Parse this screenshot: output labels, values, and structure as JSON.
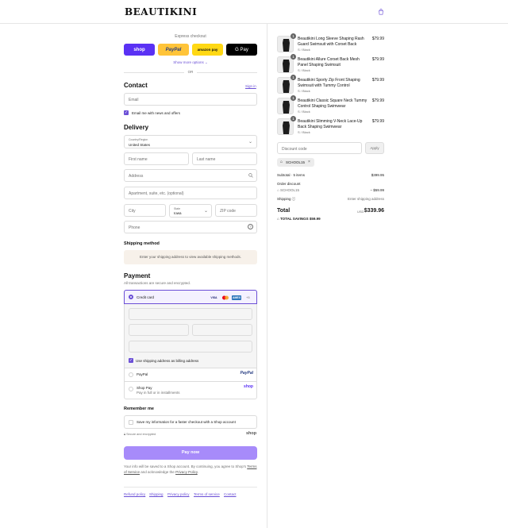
{
  "header": {
    "logo": "BEAUTIKINI"
  },
  "express": {
    "title": "Express checkout",
    "buttons": [
      {
        "label": "shop",
        "bg": "#5a31f4",
        "fg": "#ffffff"
      },
      {
        "label": "PayPal",
        "bg": "#ffc439",
        "fg": "#253b80"
      },
      {
        "label": "amazon pay",
        "bg": "#ffd814",
        "fg": "#111111"
      },
      {
        "label": "G Pay",
        "bg": "#000000",
        "fg": "#ffffff"
      }
    ],
    "more": "Show more options",
    "or": "OR"
  },
  "contact": {
    "title": "Contact",
    "signin": "Sign in",
    "email_placeholder": "Email",
    "news_label": "Email me with news and offers"
  },
  "delivery": {
    "title": "Delivery",
    "country_label": "Country/Region",
    "country_value": "United States",
    "first_name": "First name",
    "last_name": "Last name",
    "address": "Address",
    "apartment": "Apartment, suite, etc. (optional)",
    "city": "City",
    "state_label": "State",
    "state_value": "Iowa",
    "zip": "ZIP code",
    "phone": "Phone"
  },
  "shipping": {
    "title": "Shipping method",
    "notice": "Enter your shipping address to view available shipping methods."
  },
  "payment": {
    "title": "Payment",
    "subtitle": "All transactions are secure and encrypted.",
    "credit_card": "Credit card",
    "card_logos": [
      "VISA",
      "MC",
      "AMEX"
    ],
    "more_cards": "+5",
    "billing_label": "Use shipping address as billing address",
    "paypal": "PayPal",
    "paypal_logo": "PayPal",
    "shoppay": "Shop Pay",
    "shoppay_sub": "Pay in full or in installments",
    "shoppay_logo": "shop"
  },
  "remember": {
    "title": "Remember me",
    "label": "Save my information for a faster checkout with a Shop account",
    "secure": "Secure and encrypted",
    "shop_logo": "shop"
  },
  "pay_button": "Pay now",
  "legal": {
    "text1": "Your info will be saved to a Shop account. By continuing, you agree to Shop's",
    "terms": "Terms of Service",
    "and": " and acknowledge the ",
    "privacy": "Privacy Policy",
    "end": "."
  },
  "footer": {
    "links": [
      "Refund policy",
      "Shipping",
      "Privacy policy",
      "Terms of service",
      "Contact"
    ]
  },
  "cart": {
    "items": [
      {
        "qty": "1",
        "title": "Beautikini Long Sleeve Shaping Rash Guard Swimsuit with Corset Back",
        "variant": "S / Black",
        "price": "$79.99"
      },
      {
        "qty": "1",
        "title": "Beautikini Allure Corset Back Mesh Panel Shaping Swimsuit",
        "variant": "S / Black",
        "price": "$79.99"
      },
      {
        "qty": "1",
        "title": "Beautikini Sporty Zip Front Shaping Swimsuit with Tummy Control",
        "variant": "S / Black",
        "price": "$79.99"
      },
      {
        "qty": "1",
        "title": "Beautikini Classic Square Neck Tummy Control Shaping Swimwear",
        "variant": "S / Black",
        "price": "$79.99"
      },
      {
        "qty": "1",
        "title": "Beautikini Slimming V-Neck Lace-Up Back Shaping Swimwear",
        "variant": "S / Black",
        "price": "$79.99"
      }
    ],
    "discount_placeholder": "Discount code",
    "apply": "Apply",
    "code_chip": "SCHOOL15",
    "subtotal_label": "Subtotal · 5 items",
    "subtotal_value": "$399.95",
    "order_discount": "Order discount",
    "discount_code": "SCHOOL15",
    "discount_value": "− $59.99",
    "shipping_label": "Shipping",
    "shipping_value": "Enter shipping address",
    "total_label": "Total",
    "currency": "USD",
    "total_value": "$339.96",
    "savings_label": "TOTAL SAVINGS",
    "savings_value": "$59.99"
  },
  "colors": {
    "accent": "#6b4fd6",
    "pay_button": "#a78bfa",
    "notice_bg": "#f7f1ea"
  }
}
